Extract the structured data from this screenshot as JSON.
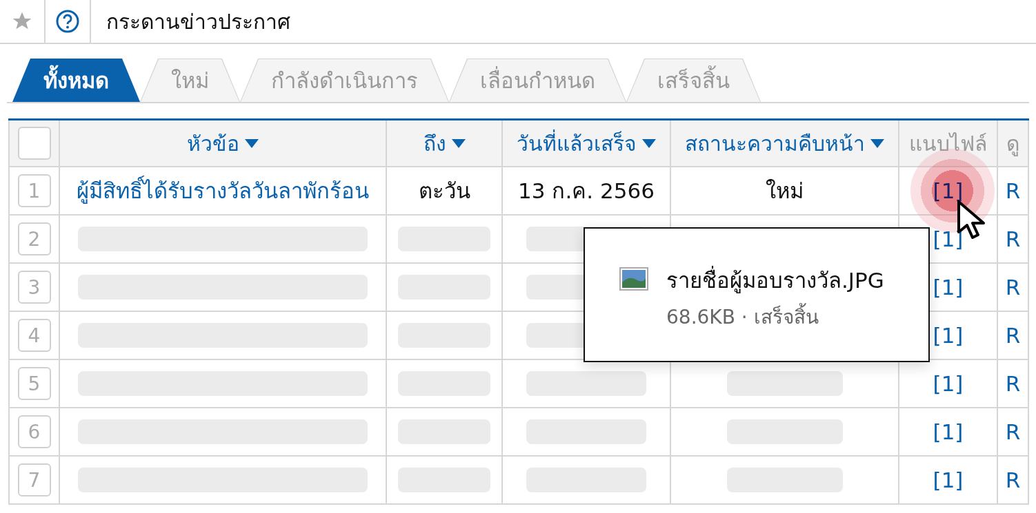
{
  "header": {
    "title": "กระดานข่าวประกาศ"
  },
  "tabs": [
    {
      "label": "ทั้งหมด",
      "selected": true
    },
    {
      "label": "ใหม่",
      "selected": false
    },
    {
      "label": "กำลังดำเนินการ",
      "selected": false
    },
    {
      "label": "เลื่อนกำหนด",
      "selected": false
    },
    {
      "label": "เสร็จสิ้น",
      "selected": false
    }
  ],
  "table": {
    "select_all_checked": false,
    "columns": [
      {
        "label": "หัวข้อ",
        "sortable": true
      },
      {
        "label": "ถึง",
        "sortable": true
      },
      {
        "label": "วันที่แล้วเสร็จ",
        "sortable": true
      },
      {
        "label": "สถานะความคืบหน้า",
        "sortable": true
      },
      {
        "label": "แนบไฟล์",
        "sortable": false
      },
      {
        "label": "ดู",
        "sortable": false
      }
    ],
    "rows": [
      {
        "kind": "data",
        "number": "1",
        "topic": "ผู้มีสิทธิ์ได้รับรางวัลวันลาพักร้อน",
        "to": "ตะวัน",
        "date": "13 ก.ค. 2566",
        "status": "ใหม่",
        "attachment": "[1]",
        "view": "R",
        "hovered": true
      },
      {
        "kind": "placeholder",
        "number": "2",
        "attachment": "[1]",
        "view": "R",
        "hovered": false
      },
      {
        "kind": "placeholder",
        "number": "3",
        "attachment": "[1]",
        "view": "R",
        "hovered": false
      },
      {
        "kind": "placeholder",
        "number": "4",
        "attachment": "[1]",
        "view": "R",
        "hovered": false
      },
      {
        "kind": "placeholder",
        "number": "5",
        "attachment": "[1]",
        "view": "R",
        "hovered": false
      },
      {
        "kind": "placeholder",
        "number": "6",
        "attachment": "[1]",
        "view": "R",
        "hovered": false
      },
      {
        "kind": "placeholder",
        "number": "7",
        "attachment": "[1]",
        "view": "R",
        "hovered": false
      }
    ]
  },
  "tooltip": {
    "file_name": "รายชื่อผู้มอบรางวัล.JPG",
    "details": "68.6KB · เสร็จสิ้น"
  }
}
